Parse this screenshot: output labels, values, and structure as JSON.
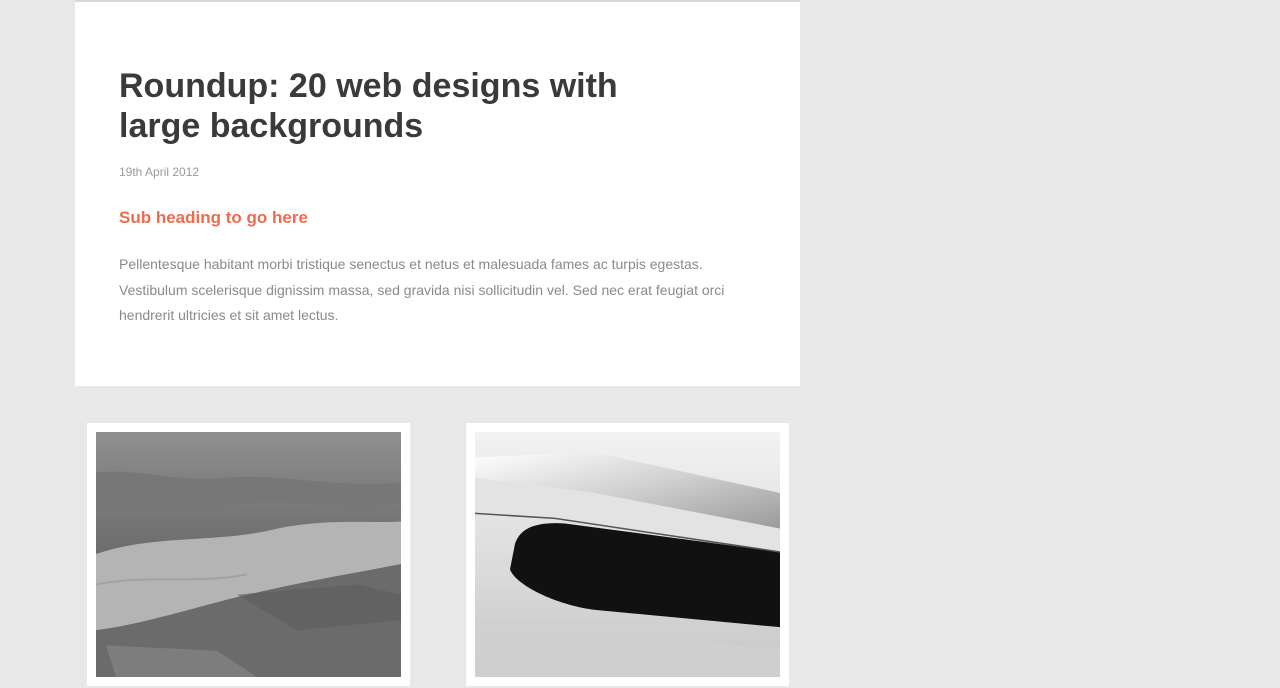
{
  "article": {
    "title": "Roundup: 20 web designs with large backgrounds",
    "date": "19th April 2012",
    "subheading": "Sub heading to go here",
    "body": "Pellentesque habitant morbi tristique senectus et netus et malesuada fames ac turpis egestas. Vestibulum scelerisque dignissim massa, sed gravida nisi sollicitudin vel. Sed nec erat feugiat orci hendrerit ultricies et sit amet lectus."
  },
  "gallery": {
    "items": [
      {
        "subject": "aerial-river-photo"
      },
      {
        "subject": "airplane-wing-photo"
      }
    ]
  },
  "colors": {
    "background": "#e8e8e8",
    "card": "#ffffff",
    "title": "#3a3a3a",
    "accent": "#ee6b4d",
    "muted": "#8a8a8a"
  }
}
